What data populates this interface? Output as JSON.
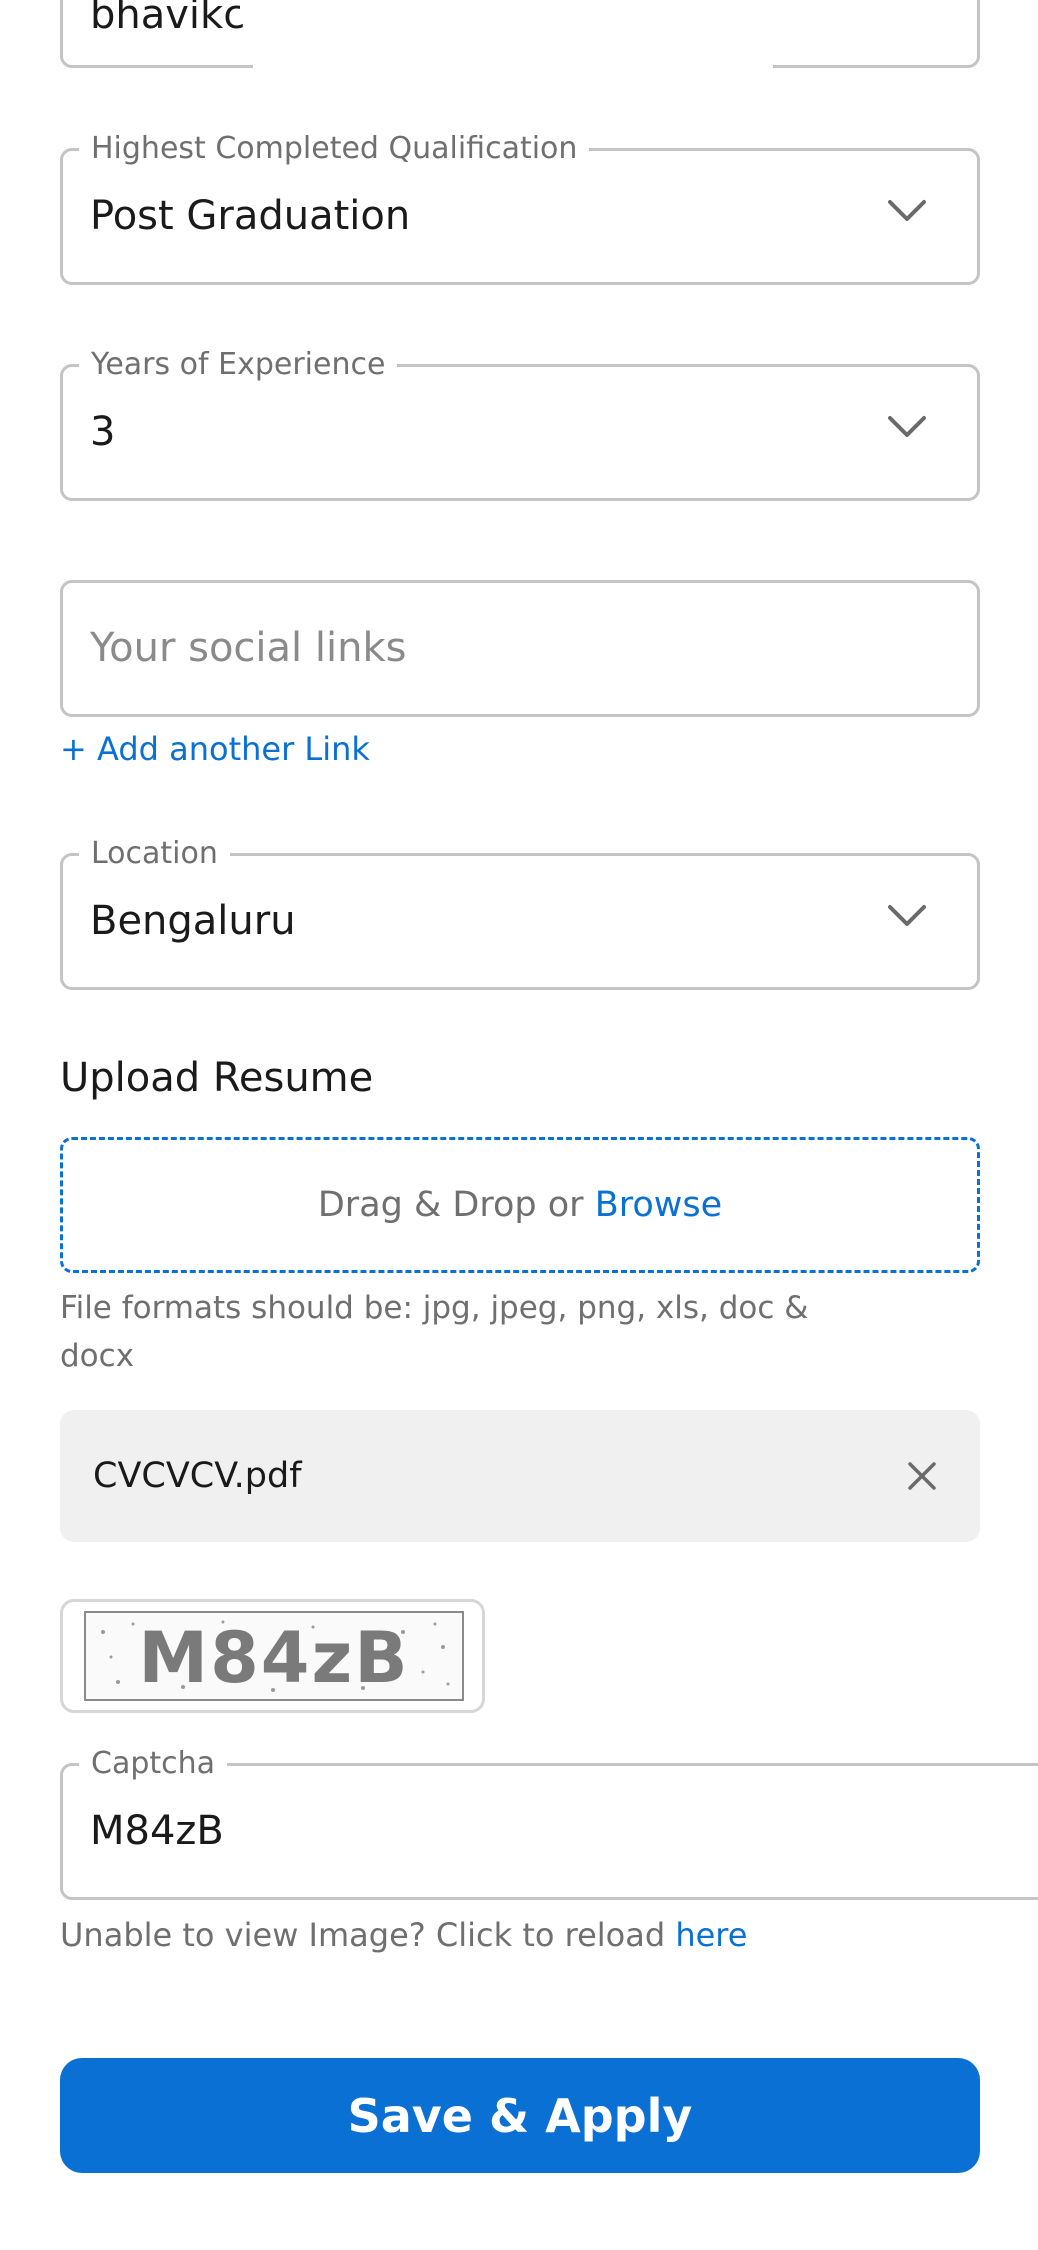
{
  "name_field": {
    "value": "bhavikc"
  },
  "qualification": {
    "label": "Highest Completed Qualification",
    "value": "Post Graduation",
    "icon": "chevron-down-icon"
  },
  "experience": {
    "label": "Years of Experience",
    "value": "3",
    "icon": "chevron-down-icon"
  },
  "social": {
    "placeholder": "Your social links",
    "add_link": "+ Add another Link"
  },
  "location": {
    "label": "Location",
    "value": "Bengaluru",
    "icon": "chevron-down-icon"
  },
  "resume": {
    "title": "Upload Resume",
    "drop_text": "Drag & Drop or",
    "browse": "Browse",
    "formats_hint": "File formats should be: jpg, jpeg, png, xls, doc & docx",
    "file_name": "CVCVCV.pdf",
    "remove_icon": "close-icon"
  },
  "captcha": {
    "image_text": "M84zB",
    "label": "Captcha",
    "value": "M84zB",
    "reload_text": "Unable to view Image? Click to reload",
    "reload_link": "here"
  },
  "submit_label": "Save & Apply",
  "colors": {
    "accent": "#0a70d4",
    "border": "#c4c4c4",
    "chip_bg": "#f0f0f0"
  }
}
